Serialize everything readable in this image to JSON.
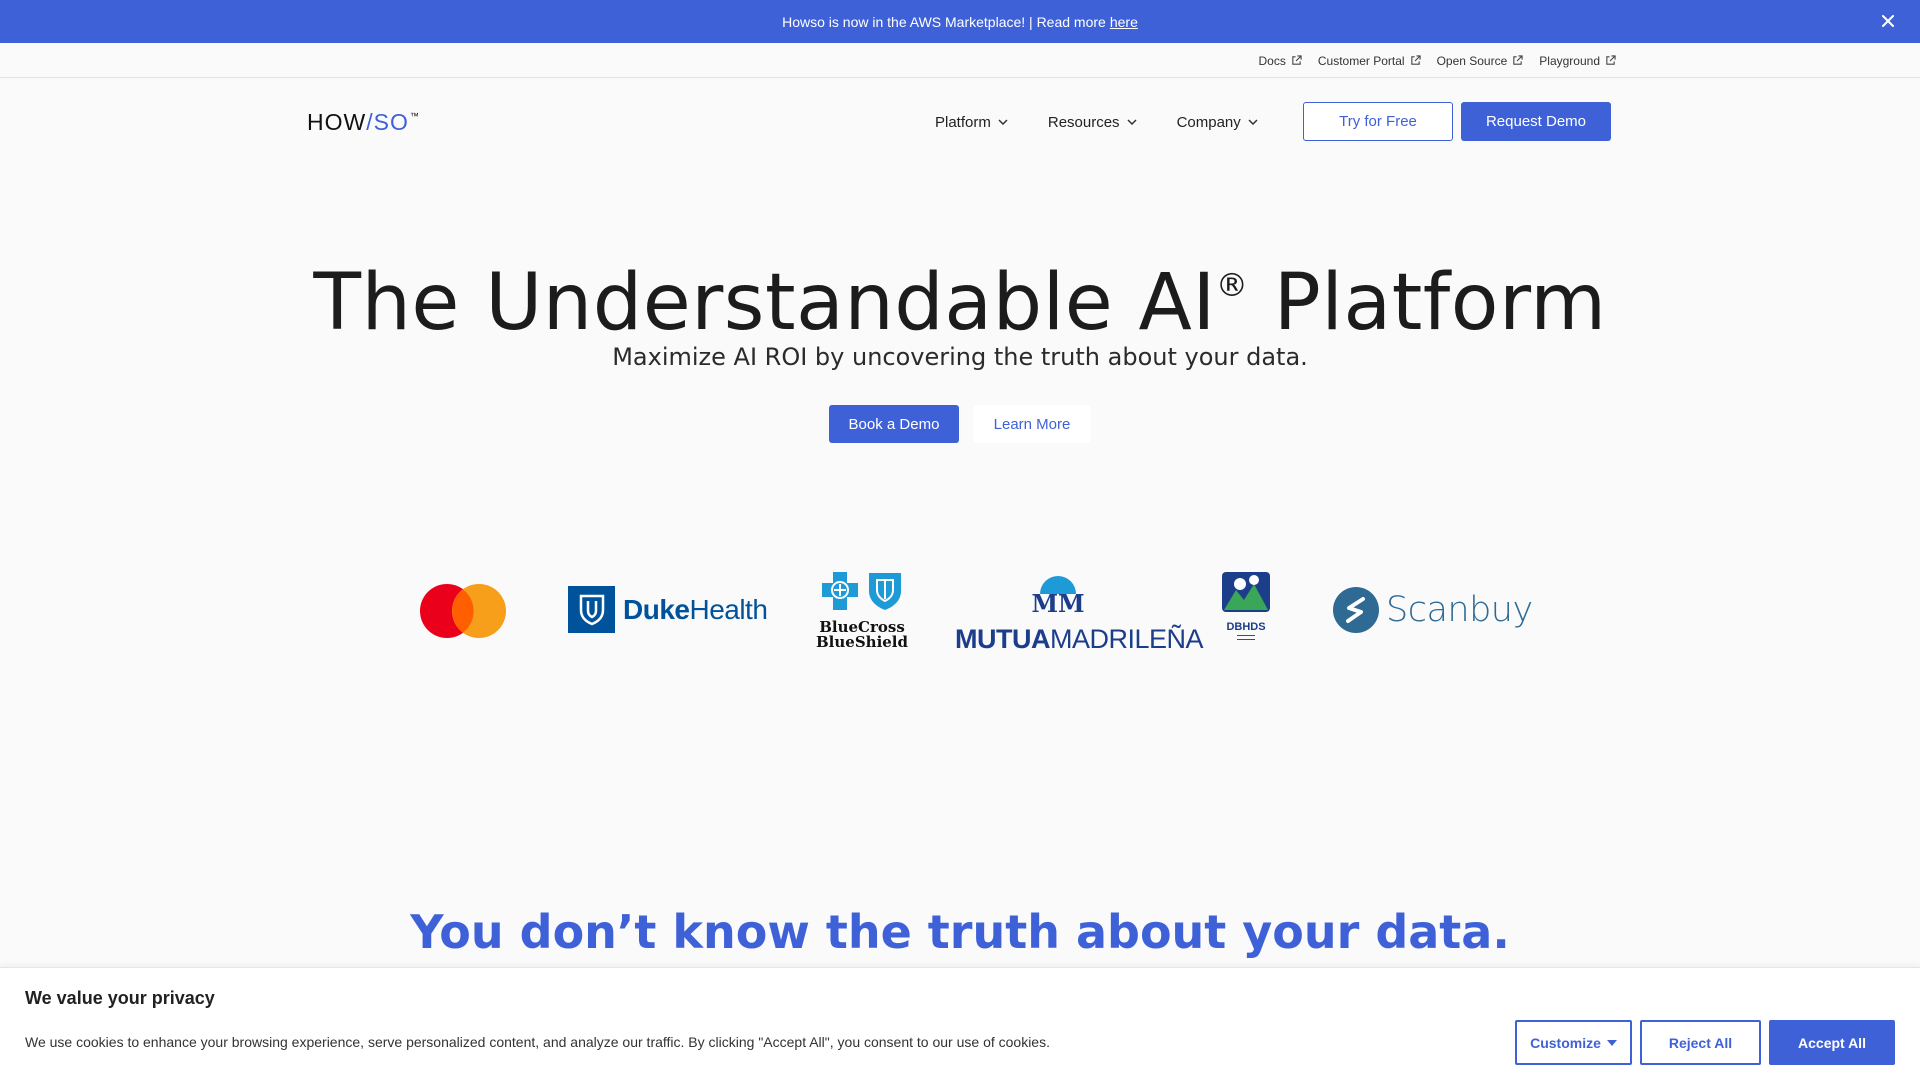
{
  "announcement": {
    "text": "Howso is now in the AWS Marketplace! | Read more",
    "link": "here",
    "bg_color": "#3f61d8"
  },
  "utility_nav": {
    "items": [
      {
        "label": "Docs",
        "icon": "external-link-icon"
      },
      {
        "label": "Customer Portal",
        "icon": "external-link-icon"
      },
      {
        "label": "Open Source",
        "icon": "external-link-icon"
      },
      {
        "label": "Playground",
        "icon": "external-link-icon"
      }
    ]
  },
  "header": {
    "logo_how": "HOW",
    "logo_slash": "/",
    "logo_so": "SO",
    "logo_tm": "™",
    "nav": [
      {
        "label": "Platform",
        "icon": "chevron-down-icon"
      },
      {
        "label": "Resources",
        "icon": "chevron-down-icon"
      },
      {
        "label": "Company",
        "icon": "chevron-down-icon"
      }
    ],
    "try_label": "Try for Free",
    "demo_label": "Request Demo",
    "accent_color": "#3f61d8"
  },
  "hero": {
    "title": "The Understandable AI",
    "title_mark": "®",
    "title_end": " Platform",
    "subtitle": "Maximize AI ROI by uncovering the truth about your data.",
    "primary_cta": "Book a Demo",
    "secondary_cta": "Learn More"
  },
  "customer_logos": {
    "duke_bold": "Duke",
    "duke_rest": "Health",
    "bcbs_line1": "BlueCross",
    "bcbs_line2": "BlueShield",
    "mutua_mark": "MM",
    "mutua_bold": "MUTUA",
    "mutua_rest": "MADRILEÑA",
    "dbhds": "DBHDS",
    "scanbuy": "Scanbuy",
    "mastercard_colors": [
      "#eb001b",
      "#f79e1b",
      "#ff5f00"
    ]
  },
  "section": {
    "headline": "You don’t know the truth about your data."
  },
  "cookie_banner": {
    "title": "We value your privacy",
    "body": "We use cookies to enhance your browsing experience, serve personalized content, and analyze our traffic. By clicking \"Accept All\", you consent to our use of cookies.",
    "customize": "Customize",
    "reject": "Reject All",
    "accept": "Accept All"
  }
}
